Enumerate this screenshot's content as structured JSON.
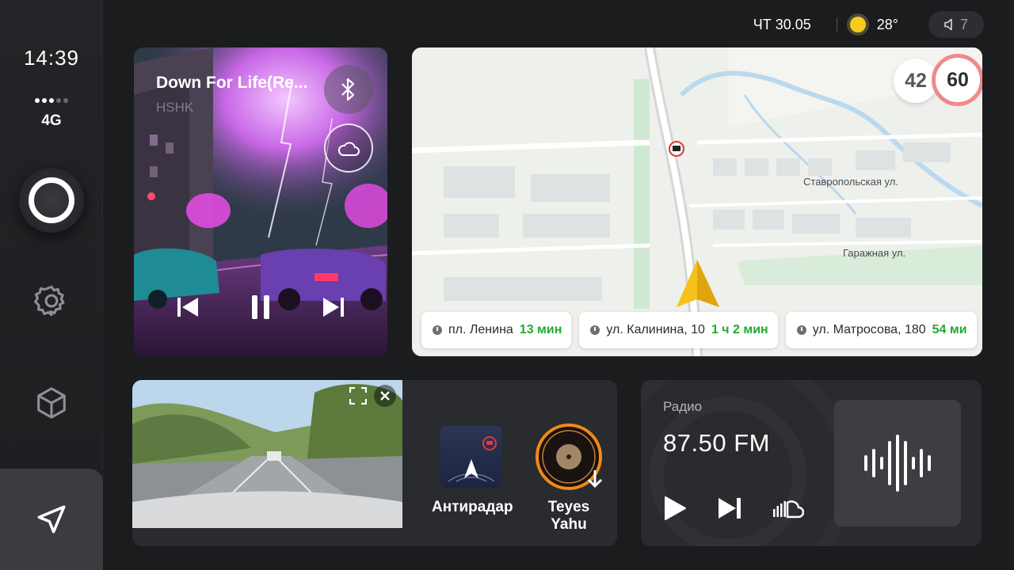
{
  "status": {
    "time": "14:39",
    "network": "4G",
    "date": "ЧТ 30.05",
    "temperature": "28°",
    "volume": "7"
  },
  "music": {
    "title": "Down For Life(Re...",
    "artist": "HSHK"
  },
  "navigation": {
    "speed_current": "42",
    "speed_limit": "60",
    "streets": [
      "Ставропольская ул.",
      "Гаражная ул."
    ],
    "routes": [
      {
        "place": "пл. Ленина",
        "eta": "13 мин"
      },
      {
        "place": "ул. Калинина, 10",
        "eta": "1 ч 2 мин"
      },
      {
        "place": "ул. Матросова, 180",
        "eta": "54 ми"
      }
    ]
  },
  "apps": [
    {
      "label": "Антирадар"
    },
    {
      "label": "Teyes Yahu"
    }
  ],
  "radio": {
    "label": "Радио",
    "frequency": "87.50 FM"
  },
  "colors": {
    "accent_green": "#22a92f",
    "speed_limit_ring": "#ef8a8a",
    "sun": "#f5cc1c"
  }
}
